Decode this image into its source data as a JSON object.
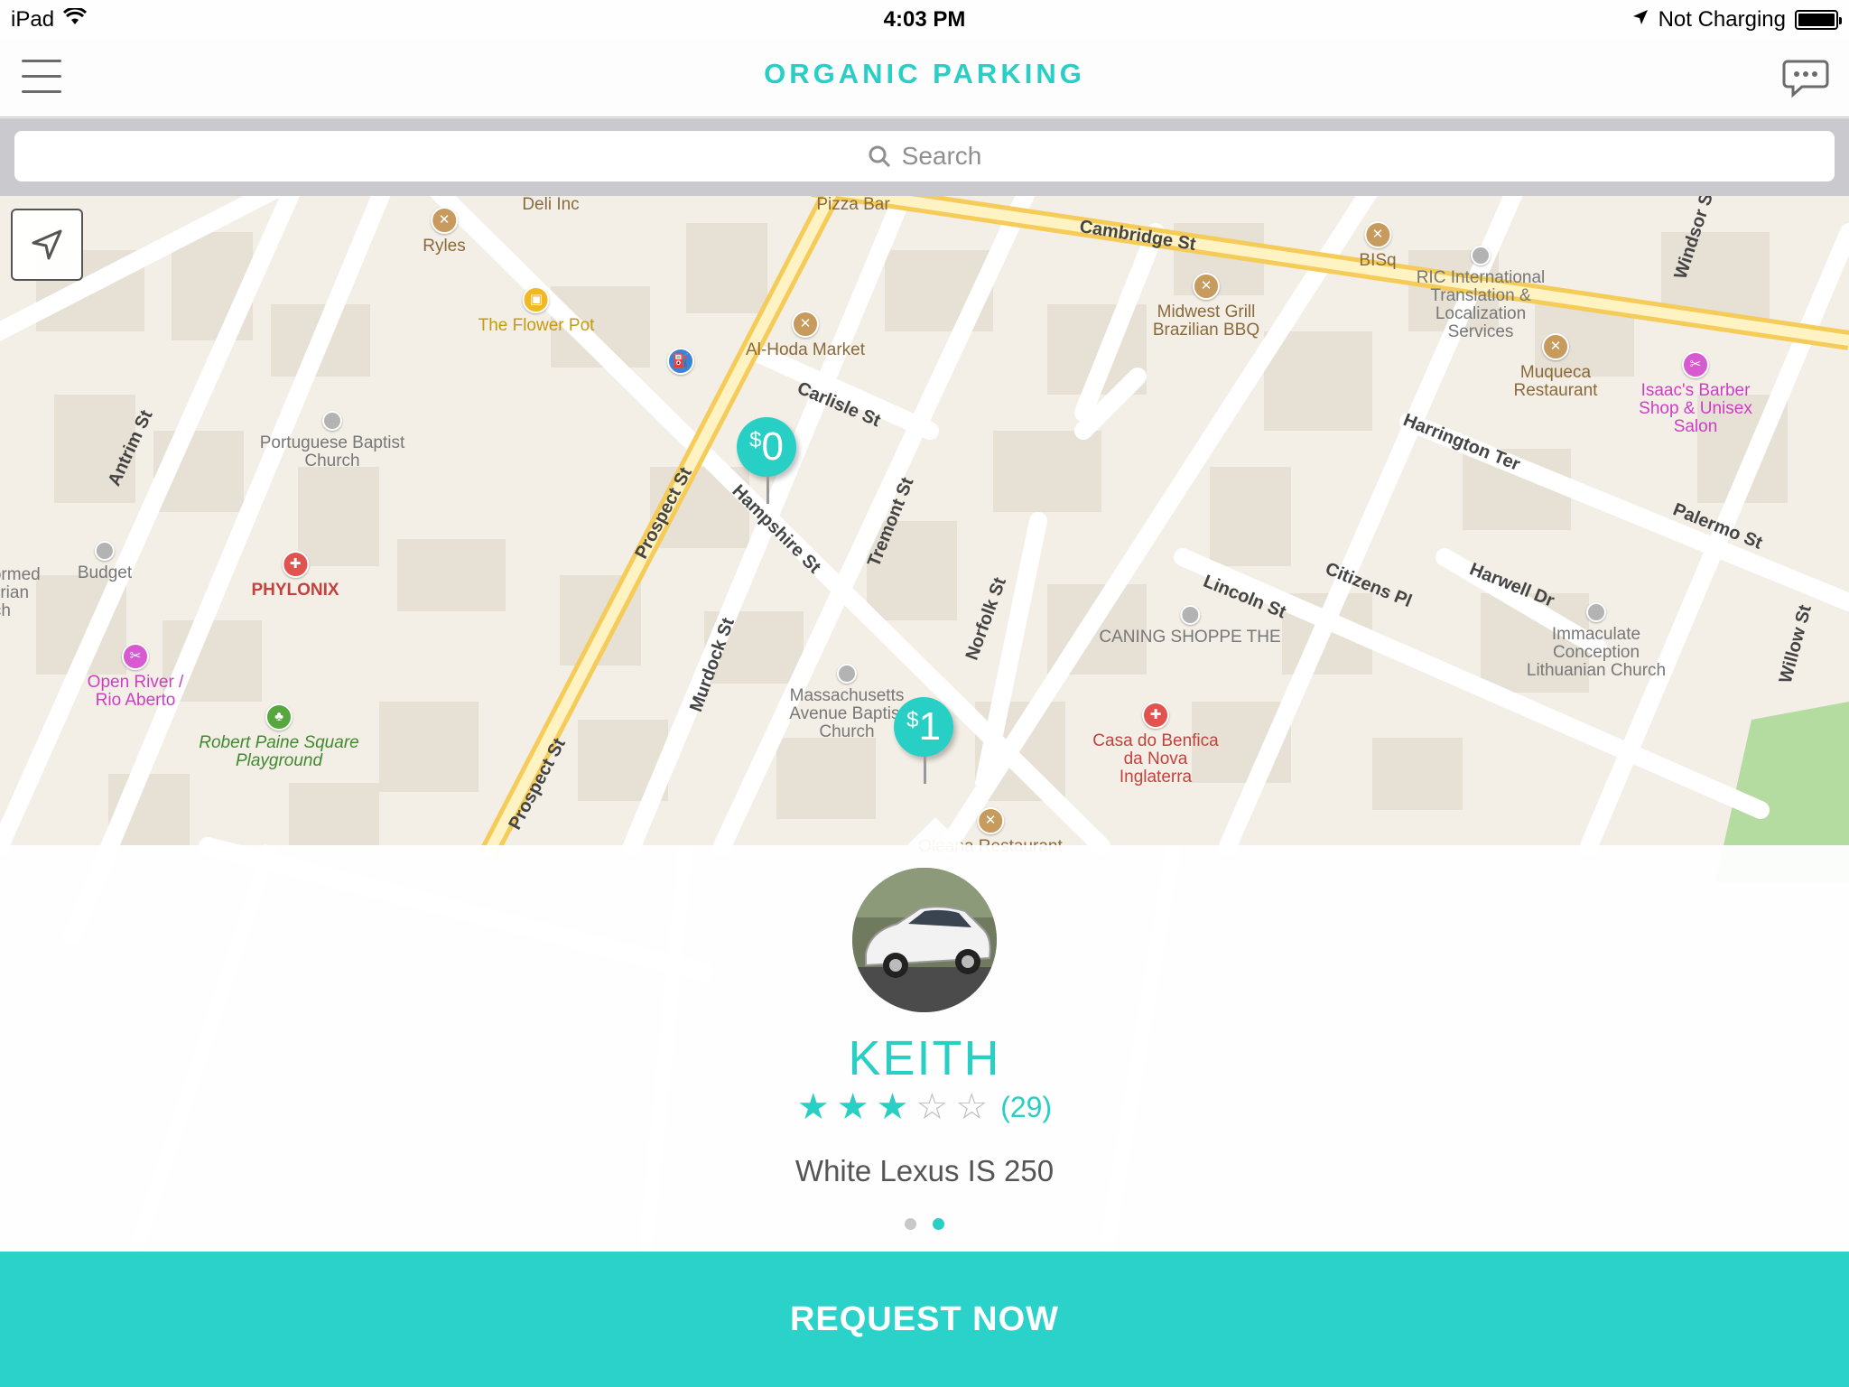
{
  "status_bar": {
    "device": "iPad",
    "time": "4:03 PM",
    "battery_text": "Not Charging"
  },
  "nav": {
    "title": "ORGANIC PARKING"
  },
  "search": {
    "placeholder": "Search"
  },
  "map": {
    "pois": [
      {
        "name": "S & S Restaurant & Deli Inc",
        "color": "#a57a3e"
      },
      {
        "name": "Ryles",
        "color": "#c79a5e"
      },
      {
        "name": "Pizza Bar",
        "color": "#a57a3e"
      },
      {
        "name": "The Flower Pot",
        "color": "#f2b824"
      },
      {
        "name": "Al-Hoda Market",
        "color": "#c79a5e"
      },
      {
        "name": "Portuguese Baptist Church",
        "color": "#b3b3b3"
      },
      {
        "name": "Budget",
        "color": "#b3b3b3"
      },
      {
        "name": "PHYLONIX",
        "color": "#e2534f"
      },
      {
        "name": "Open River / Rio Aberto",
        "color": "#d85ad0"
      },
      {
        "name": "Robert Paine Square Playground",
        "color": "#56a83e"
      },
      {
        "name": "Massachusetts Avenue Baptist Church",
        "color": "#b3b3b3"
      },
      {
        "name": "Midwest Grill Brazilian BBQ",
        "color": "#c79a5e"
      },
      {
        "name": "BISq",
        "color": "#c79a5e"
      },
      {
        "name": "RIC International Translation & Localization Services",
        "color": "#b3b3b3"
      },
      {
        "name": "Muqueca Restaurant",
        "color": "#c79a5e"
      },
      {
        "name": "Isaac's Barber Shop & Unisex Salon",
        "color": "#d85ad0"
      },
      {
        "name": "CANING SHOPPE THE",
        "color": "#b3b3b3"
      },
      {
        "name": "Casa do Benfica da Nova Inglaterra",
        "color": "#e2534f"
      },
      {
        "name": "Immaculate Conception Lithuanian Church",
        "color": "#b3b3b3"
      },
      {
        "name": "Oleana Restaurant",
        "color": "#c79a5e"
      },
      {
        "name": "eformed yterian urch",
        "color": "#b3b3b3"
      }
    ],
    "streets": [
      "Cambridge St",
      "Prospect St",
      "Hampshire St",
      "Carlisle St",
      "Tremont St",
      "Norfolk St",
      "Murdock St",
      "Antrim St",
      "Harrington Ter",
      "Palermo St",
      "Lincoln St",
      "Citizens Pl",
      "Harwell Dr",
      "Windsor St",
      "Willow St",
      "Prospect St"
    ],
    "pins": [
      {
        "label": "0",
        "currency": "$"
      },
      {
        "label": "1",
        "currency": "$"
      }
    ]
  },
  "driver": {
    "name": "KEITH",
    "rating": 3,
    "rating_max": 5,
    "review_count": "(29)",
    "car": "White Lexus IS 250"
  },
  "pager": {
    "pages": 2,
    "active": 1
  },
  "actions": {
    "request": "REQUEST NOW"
  },
  "colors": {
    "accent": "#27cfc4",
    "button": "#2ad2c9"
  }
}
